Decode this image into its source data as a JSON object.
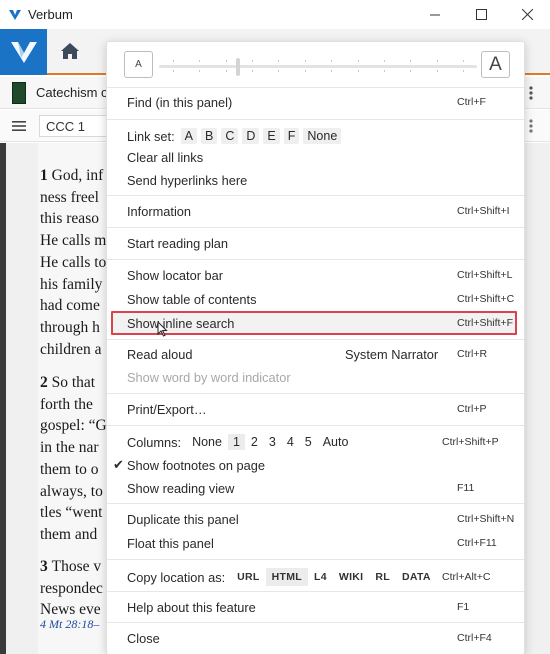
{
  "window": {
    "title": "Verbum",
    "controls": [
      "minimize",
      "maximize",
      "close"
    ]
  },
  "toolbar": {
    "logo": "verbum-logo",
    "home": "home-icon"
  },
  "panel": {
    "title": "Catechism of",
    "reference": "CCC 1"
  },
  "reader": {
    "paragraphs": [
      {
        "num": "1",
        "lines": [
          "God, inf",
          "ness freel",
          "this reaso",
          "He calls m",
          "He calls to",
          "his family",
          "had come",
          "through h",
          "children a"
        ]
      },
      {
        "num": "2",
        "lines": [
          "So that",
          "forth the",
          "gospel: “G",
          "in the nar",
          "them to o",
          "always, to",
          "tles “went",
          "them and"
        ]
      },
      {
        "num": "3",
        "lines": [
          "Those v",
          "respondec",
          "News eve"
        ]
      }
    ],
    "footnote": "4 Mt 28:18–"
  },
  "menu": {
    "text_size": {
      "small_label": "A",
      "large_label": "A",
      "level": 0.25,
      "ticks": 12
    },
    "find": {
      "label": "Find (in this panel)",
      "shortcut": "Ctrl+F"
    },
    "link_set": {
      "label": "Link set:",
      "options": [
        "A",
        "B",
        "C",
        "D",
        "E",
        "F",
        "None"
      ]
    },
    "clear_links": {
      "label": "Clear all links"
    },
    "send_hyperlinks": {
      "label": "Send hyperlinks here"
    },
    "information": {
      "label": "Information",
      "shortcut": "Ctrl+Shift+I"
    },
    "reading_plan": {
      "label": "Start reading plan"
    },
    "locator_bar": {
      "label": "Show locator bar",
      "shortcut": "Ctrl+Shift+L"
    },
    "toc": {
      "label": "Show table of contents",
      "shortcut": "Ctrl+Shift+C"
    },
    "inline_search": {
      "label": "Show inline search",
      "shortcut": "Ctrl+Shift+F"
    },
    "read_aloud": {
      "label": "Read aloud",
      "voice": "System Narrator",
      "shortcut": "Ctrl+R"
    },
    "word_indicator": {
      "label": "Show word by word indicator"
    },
    "print": {
      "label": "Print/Export…",
      "shortcut": "Ctrl+P"
    },
    "columns": {
      "label": "Columns:",
      "options": [
        "None",
        "1",
        "2",
        "3",
        "4",
        "5",
        "Auto"
      ],
      "selected": "1",
      "shortcut": "Ctrl+Shift+P"
    },
    "footnotes": {
      "label": "Show footnotes on page",
      "checked": true,
      "check": "✔"
    },
    "reading_view": {
      "label": "Show reading view",
      "shortcut": "F11"
    },
    "duplicate": {
      "label": "Duplicate this panel",
      "shortcut": "Ctrl+Shift+N"
    },
    "float": {
      "label": "Float this panel",
      "shortcut": "Ctrl+F11"
    },
    "copy_location": {
      "label": "Copy location as:",
      "options": [
        "URL",
        "HTML",
        "L4",
        "WIKI",
        "RL",
        "DATA"
      ],
      "selected": "HTML",
      "shortcut": "Ctrl+Alt+C"
    },
    "help": {
      "label": "Help about this feature",
      "shortcut": "F1"
    },
    "close": {
      "label": "Close",
      "shortcut": "Ctrl+F4"
    }
  },
  "colors": {
    "brand_blue": "#1a73c4",
    "accent_orange": "#e07a2a",
    "highlight_red": "#d9434b",
    "footnote_link": "#1a4aa0"
  }
}
